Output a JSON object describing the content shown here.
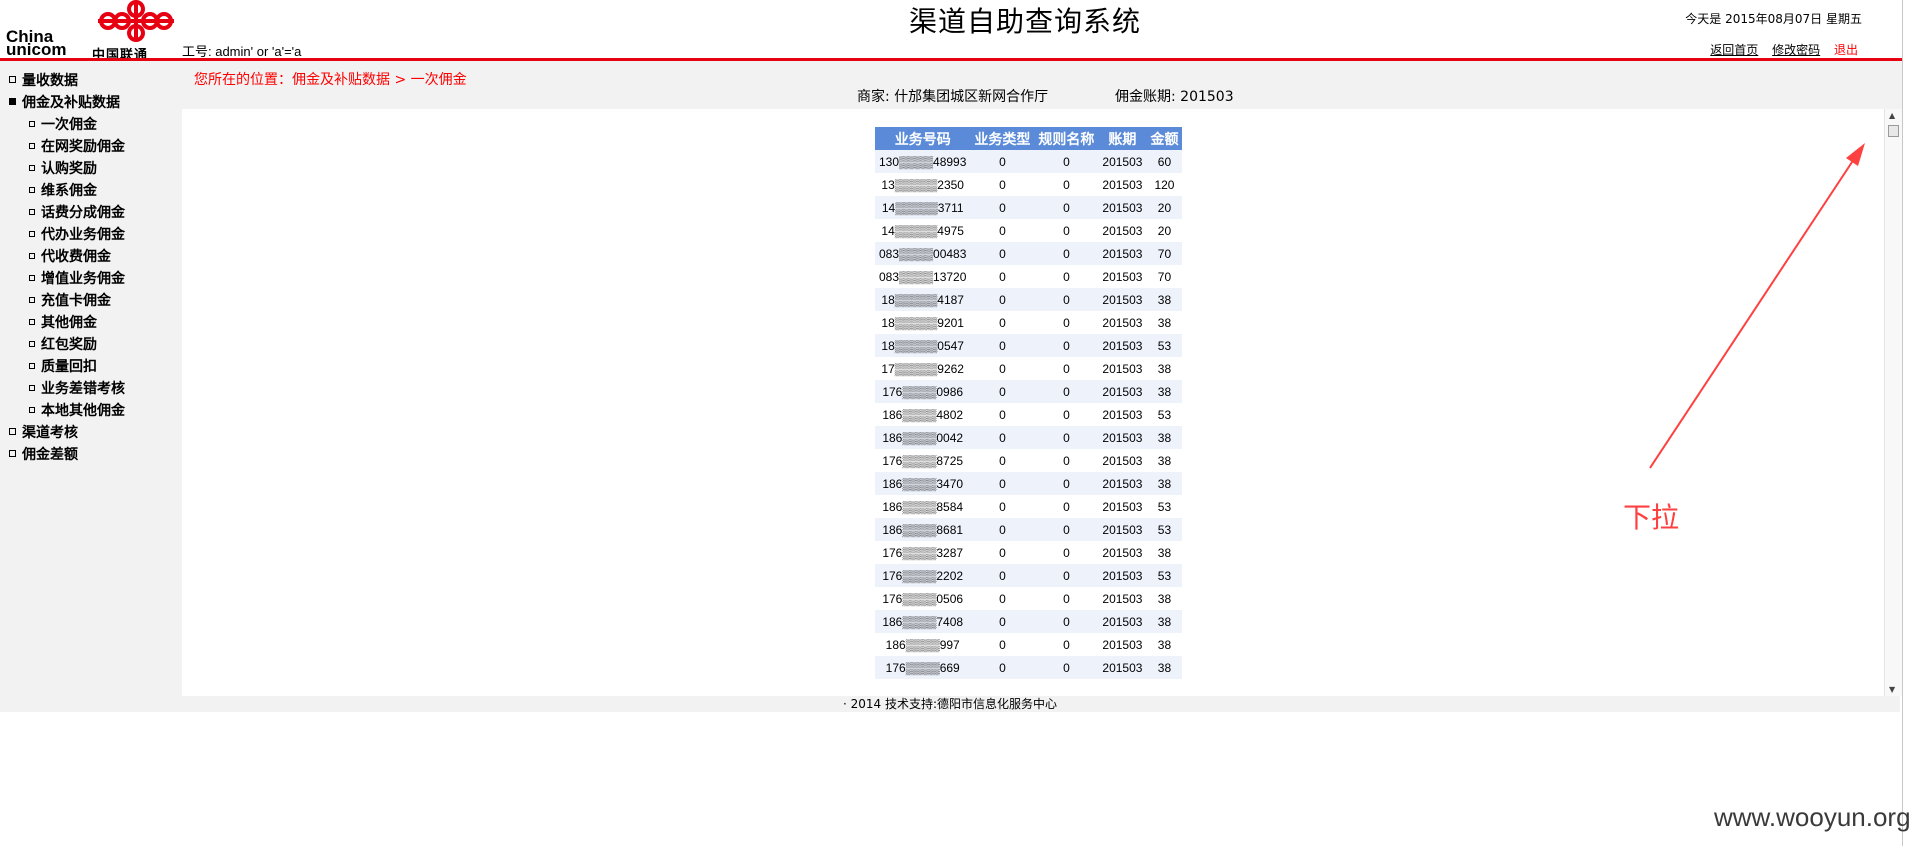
{
  "header": {
    "logo": {
      "text_en_1": "China",
      "text_en_2": "unicom",
      "text_cn": "中国联通",
      "color": "#e60012"
    },
    "staff_id": "工号: admin' or 'a'='a",
    "title": "渠道自助查询系统",
    "today": "今天是 2015年08月07日  星期五",
    "links": {
      "home": "返回首页",
      "change_password": "修改密码",
      "logout": "退出"
    }
  },
  "sidebar": {
    "items": [
      {
        "label": "量收数据",
        "level": 1,
        "expanded": false
      },
      {
        "label": "佣金及补贴数据",
        "level": 1,
        "expanded": true
      },
      {
        "label": "一次佣金",
        "level": 2
      },
      {
        "label": "在网奖励佣金",
        "level": 2
      },
      {
        "label": "认购奖励",
        "level": 2
      },
      {
        "label": "维系佣金",
        "level": 2
      },
      {
        "label": "话费分成佣金",
        "level": 2
      },
      {
        "label": "代办业务佣金",
        "level": 2
      },
      {
        "label": "代收费佣金",
        "level": 2
      },
      {
        "label": "增值业务佣金",
        "level": 2
      },
      {
        "label": "充值卡佣金",
        "level": 2
      },
      {
        "label": "其他佣金",
        "level": 2
      },
      {
        "label": "红包奖励",
        "level": 2
      },
      {
        "label": "质量回扣",
        "level": 2
      },
      {
        "label": "业务差错考核",
        "level": 2
      },
      {
        "label": "本地其他佣金",
        "level": 2
      },
      {
        "label": "渠道考核",
        "level": 1,
        "expanded": false
      },
      {
        "label": "佣金差额",
        "level": 1,
        "expanded": false
      }
    ]
  },
  "main": {
    "breadcrumb": "您所在的位置：佣金及补贴数据 > 一次佣金",
    "merchant": "商家:  什邡集团城区新网合作厅",
    "period": "佣金账期: 201503",
    "table": {
      "headers": [
        "业务号码",
        "业务类型",
        "规则名称",
        "账期",
        "金额"
      ],
      "rows": [
        [
          "130▒▒▒▒48993",
          "0",
          "0",
          "201503",
          "60"
        ],
        [
          "13▒▒▒▒▒2350",
          "0",
          "0",
          "201503",
          "120"
        ],
        [
          "14▒▒▒▒▒3711",
          "0",
          "0",
          "201503",
          "20"
        ],
        [
          "14▒▒▒▒▒4975",
          "0",
          "0",
          "201503",
          "20"
        ],
        [
          "083▒▒▒▒00483",
          "0",
          "0",
          "201503",
          "70"
        ],
        [
          "083▒▒▒▒13720",
          "0",
          "0",
          "201503",
          "70"
        ],
        [
          "18▒▒▒▒▒4187",
          "0",
          "0",
          "201503",
          "38"
        ],
        [
          "18▒▒▒▒▒9201",
          "0",
          "0",
          "201503",
          "38"
        ],
        [
          "18▒▒▒▒▒0547",
          "0",
          "0",
          "201503",
          "53"
        ],
        [
          "17▒▒▒▒▒9262",
          "0",
          "0",
          "201503",
          "38"
        ],
        [
          "176▒▒▒▒0986",
          "0",
          "0",
          "201503",
          "38"
        ],
        [
          "186▒▒▒▒4802",
          "0",
          "0",
          "201503",
          "53"
        ],
        [
          "186▒▒▒▒0042",
          "0",
          "0",
          "201503",
          "38"
        ],
        [
          "176▒▒▒▒8725",
          "0",
          "0",
          "201503",
          "38"
        ],
        [
          "186▒▒▒▒3470",
          "0",
          "0",
          "201503",
          "38"
        ],
        [
          "186▒▒▒▒8584",
          "0",
          "0",
          "201503",
          "53"
        ],
        [
          "186▒▒▒▒8681",
          "0",
          "0",
          "201503",
          "53"
        ],
        [
          "176▒▒▒▒3287",
          "0",
          "0",
          "201503",
          "38"
        ],
        [
          "176▒▒▒▒2202",
          "0",
          "0",
          "201503",
          "53"
        ],
        [
          "176▒▒▒▒0506",
          "0",
          "0",
          "201503",
          "38"
        ],
        [
          "186▒▒▒▒7408",
          "0",
          "0",
          "201503",
          "38"
        ],
        [
          "186▒▒▒▒997",
          "0",
          "0",
          "201503",
          "38"
        ],
        [
          "176▒▒▒▒669",
          "0",
          "0",
          "201503",
          "38"
        ]
      ]
    }
  },
  "footer": "· 2014 技术支持:德阳市信息化服务中心",
  "annotation": {
    "label": "下拉",
    "color": "#ff4040"
  },
  "watermark": "www.wooyun.org"
}
